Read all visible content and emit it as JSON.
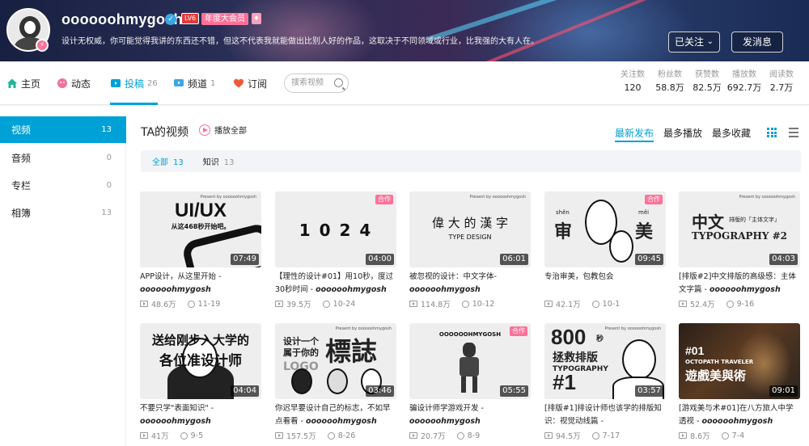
{
  "profile": {
    "username": "oooooohmygosh",
    "level": "LV6",
    "vip_label": "年度大会员",
    "signature": "设计无权威，你可能觉得我讲的东西还不错，但这不代表我就能做出比别人好的作品，这取决于不同领域或行业，比我强的大有人在。",
    "follow_label": "已关注",
    "message_label": "发消息"
  },
  "nav": {
    "home": "主页",
    "dynamic": "动态",
    "videos": "投稿",
    "videos_count": "26",
    "channels": "频道",
    "channels_count": "1",
    "subs": "订阅",
    "search_placeholder": "搜索视频"
  },
  "stats": [
    {
      "label": "关注数",
      "value": "120"
    },
    {
      "label": "粉丝数",
      "value": "58.8万"
    },
    {
      "label": "获赞数",
      "value": "82.5万"
    },
    {
      "label": "播放数",
      "value": "692.7万"
    },
    {
      "label": "阅读数",
      "value": "2.7万"
    }
  ],
  "sidebar": {
    "items": [
      {
        "label": "视频",
        "count": "13"
      },
      {
        "label": "音频",
        "count": "0"
      },
      {
        "label": "专栏",
        "count": "0"
      },
      {
        "label": "相簿",
        "count": "13"
      }
    ]
  },
  "main": {
    "title": "TA的视频",
    "play_all": "播放全部",
    "sort": [
      "最新发布",
      "最多播放",
      "最多收藏"
    ],
    "filters": [
      {
        "label": "全部",
        "count": "13"
      },
      {
        "label": "知识",
        "count": "13"
      }
    ]
  },
  "thumb_text": {
    "present": "Present by oooooohmygosh",
    "coop": "合作",
    "uiux": "UI/UX",
    "uiux_sub": "从这468秒开始吧。",
    "num1024": "1 0 2 4",
    "hanzi": "偉 大 的 漢 字",
    "type_design": "TYPE DESIGN",
    "shen": "审",
    "mei": "美",
    "shen_py": "shěn",
    "mei_py": "měi",
    "zhongwen": "中文",
    "zhongwen_sub": "排版的「主体文字」",
    "typo2": "TYPOGRAPHY #2",
    "songgei1": "送给刚步入大学的",
    "songgei2": "各位准设计师",
    "logo1": "设计一个",
    "logo2": "属于你的",
    "logo_big": "標誌",
    "logo_en": "LOGO",
    "game_present": "OOOOOOHMYGOSH",
    "n800": "800",
    "n800_sec": "秒",
    "rescue": "拯救排版",
    "typography": "TYPOGRAPHY",
    "n1": "#1",
    "octo1": "#01",
    "octo2": "OCTOPATH TRAVELER",
    "octo3": "遊戲美與術"
  },
  "videos": [
    {
      "title": "APP设计，从这里开始 - ",
      "author": "oooooohmygosh",
      "duration": "07:49",
      "plays": "48.6万",
      "date": "11-19",
      "coop": false
    },
    {
      "title": "【理性的设计#01】用10秒，度过30秒时间 - ",
      "author": "oooooohmygosh",
      "duration": "04:00",
      "plays": "39.5万",
      "date": "10-24",
      "coop": true
    },
    {
      "title": "被忽视的设计：中文字体- ",
      "author": "oooooohmygosh",
      "duration": "06:01",
      "plays": "114.8万",
      "date": "10-12",
      "coop": false
    },
    {
      "title": "专治审美，包教包会",
      "author": "",
      "duration": "09:45",
      "plays": "42.1万",
      "date": "10-1",
      "coop": true
    },
    {
      "title": "[排版#2]中文排版的高级感：主体文字篇 - ",
      "author": "oooooohmygosh",
      "duration": "04:03",
      "plays": "52.4万",
      "date": "9-16",
      "coop": false
    },
    {
      "title": "不要只学\"表面知识\" - ",
      "author": "oooooohmygosh",
      "duration": "04:04",
      "plays": "41万",
      "date": "9-5",
      "coop": false
    },
    {
      "title": "你迟早要设计自己的标志，不如早点看看 - ",
      "author": "oooooohmygosh",
      "duration": "03:46",
      "plays": "157.5万",
      "date": "8-26",
      "coop": false
    },
    {
      "title": "骗设计师学游戏开发 - ",
      "author": "oooooohmygosh",
      "duration": "05:55",
      "plays": "20.7万",
      "date": "8-9",
      "coop": true
    },
    {
      "title": "[排版#1]排设计师也该学的排版知识：视觉动线篇 - ",
      "author": "",
      "duration": "03:57",
      "plays": "94.5万",
      "date": "7-17",
      "coop": false
    },
    {
      "title": "[游戏美与术#01]在八方旅人中学透视 - ",
      "author": "oooooohmygosh",
      "duration": "09:01",
      "plays": "8.6万",
      "date": "7-4",
      "coop": false
    }
  ]
}
